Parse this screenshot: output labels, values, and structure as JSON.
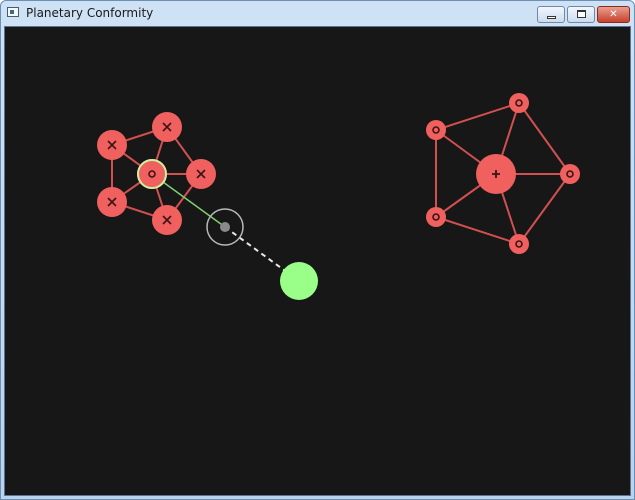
{
  "window": {
    "title": "Planetary Conformity",
    "minimize_icon": "minimize-icon",
    "maximize_icon": "maximize-icon",
    "close_icon": "close-icon",
    "close_glyph": "✕"
  },
  "colors": {
    "background": "#171717",
    "planet": "#f0605e",
    "planet_glyph": "#3a1515",
    "edge": "#d15050",
    "player": "#99ff88",
    "selected_ring": "#ccf0a0",
    "aim_line": "#7ecf6e",
    "reticle": "#b8b8b8",
    "trajectory": "#e8e8e8"
  },
  "game": {
    "clusters": [
      {
        "id": "left-cluster",
        "nodes": [
          {
            "id": "l-center",
            "symbol": "circle",
            "selected": true
          },
          {
            "id": "l-top",
            "symbol": "cross"
          },
          {
            "id": "l-right",
            "symbol": "cross"
          },
          {
            "id": "l-bottom-right",
            "symbol": "cross"
          },
          {
            "id": "l-bottom-left",
            "symbol": "cross"
          },
          {
            "id": "l-top-left",
            "symbol": "cross"
          }
        ]
      },
      {
        "id": "right-cluster",
        "nodes": [
          {
            "id": "r-center",
            "symbol": "plus"
          },
          {
            "id": "r-top",
            "symbol": "circle"
          },
          {
            "id": "r-right",
            "symbol": "circle"
          },
          {
            "id": "r-bottom",
            "symbol": "circle"
          },
          {
            "id": "r-bottom-left",
            "symbol": "circle"
          },
          {
            "id": "r-top-left",
            "symbol": "circle"
          }
        ]
      }
    ],
    "player": {
      "state": "free"
    },
    "reticle": {
      "state": "aiming"
    }
  }
}
